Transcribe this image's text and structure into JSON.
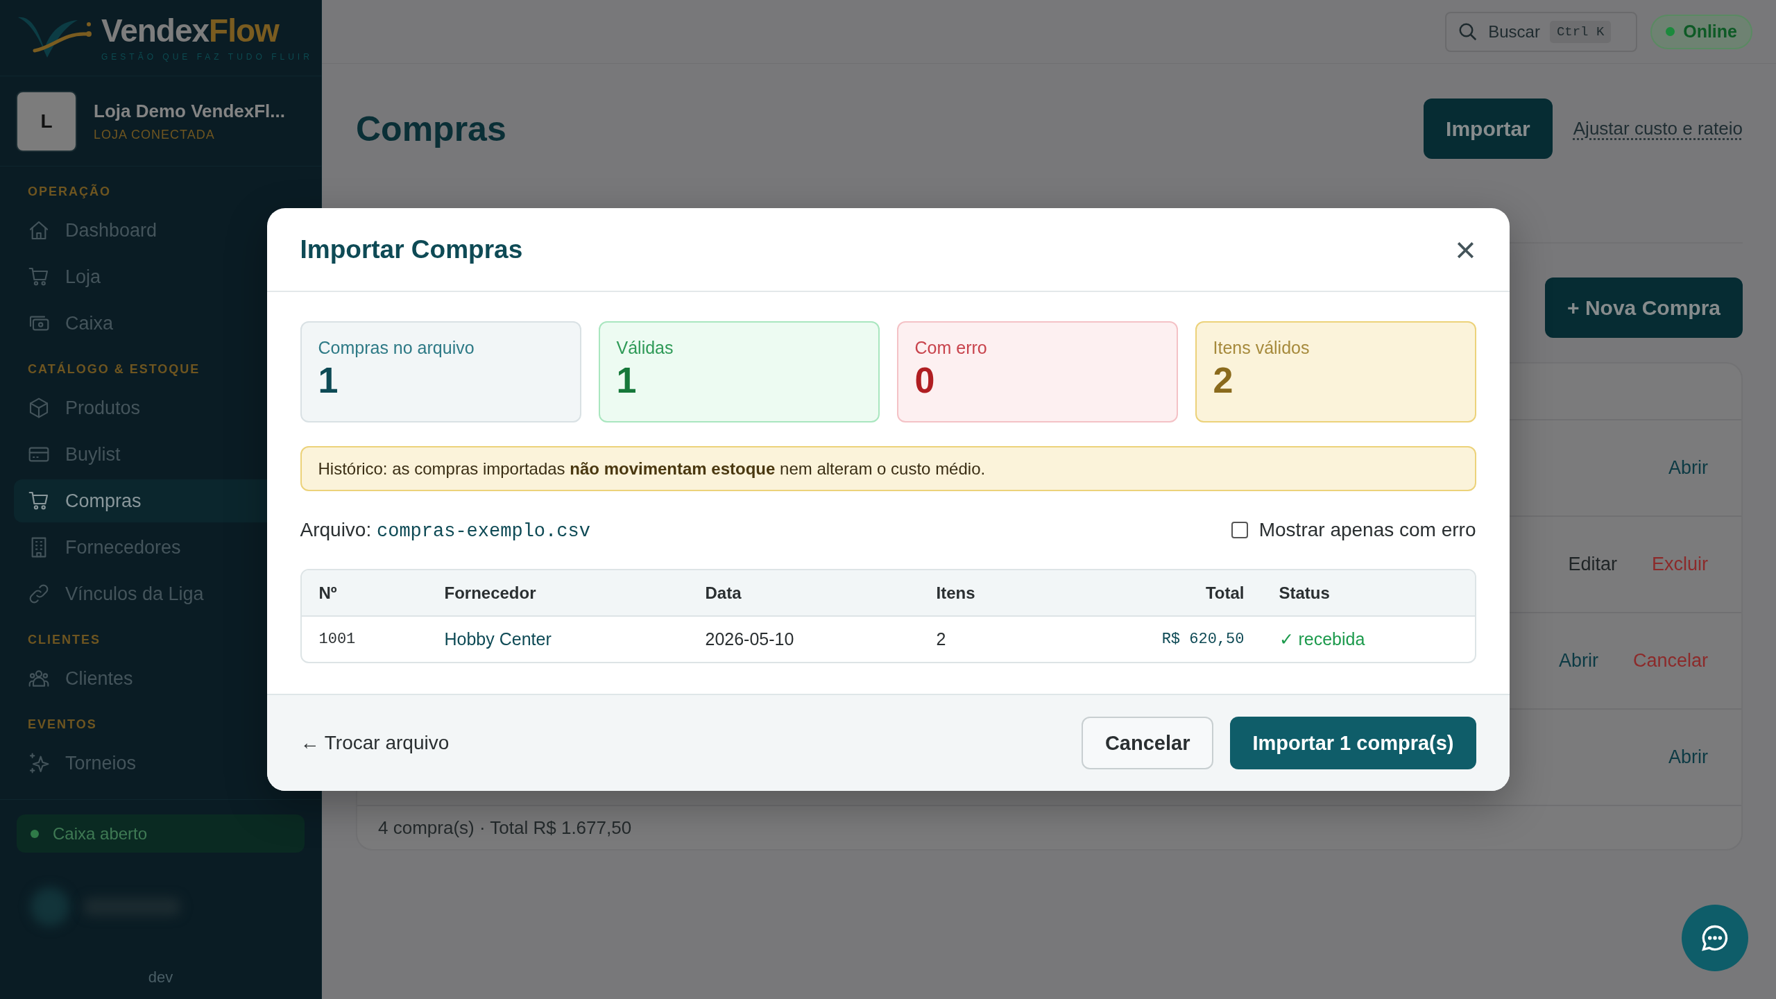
{
  "brand": {
    "name_main": "Vendex",
    "name_accent": "Flow",
    "tagline": "GESTÃO QUE FAZ TUDO FLUIR"
  },
  "store": {
    "initial": "L",
    "name": "Loja Demo VendexFl...",
    "status": "LOJA CONECTADA"
  },
  "sidebar": {
    "sections": [
      {
        "title": "OPERAÇÃO",
        "items": [
          {
            "kind": "home",
            "label": "Dashboard",
            "selected": false
          },
          {
            "kind": "shop",
            "label": "Loja",
            "selected": false
          },
          {
            "kind": "cash",
            "label": "Caixa",
            "selected": false
          }
        ]
      },
      {
        "title": "CATÁLOGO & ESTOQUE",
        "items": [
          {
            "kind": "products",
            "label": "Produtos",
            "selected": false
          },
          {
            "kind": "buylist",
            "label": "Buylist",
            "selected": false
          },
          {
            "kind": "shop",
            "label": "Compras",
            "selected": true
          },
          {
            "kind": "suppliers",
            "label": "Fornecedores",
            "selected": false
          },
          {
            "kind": "links",
            "label": "Vínculos da Liga",
            "selected": false
          }
        ]
      },
      {
        "title": "CLIENTES",
        "items": [
          {
            "kind": "customers",
            "label": "Clientes",
            "selected": false
          }
        ]
      },
      {
        "title": "EVENTOS",
        "items": [
          {
            "kind": "events",
            "label": "Torneios",
            "selected": false
          }
        ]
      }
    ],
    "register_status": "Caixa aberto",
    "env": "dev"
  },
  "topbar": {
    "search": {
      "label": "Buscar",
      "shortcut": "Ctrl K"
    },
    "status": "Online"
  },
  "page": {
    "title": "Compras",
    "import_button": "Importar",
    "adjust_link": "Ajustar custo e rateio",
    "new_button": "+ Nova Compra",
    "rows": [
      {
        "actions": [
          {
            "kind": "open",
            "label": "Abrir"
          }
        ]
      },
      {
        "actions": [
          {
            "kind": "edit",
            "label": "Editar"
          },
          {
            "kind": "delete",
            "label": "Excluir"
          }
        ]
      },
      {
        "actions": [
          {
            "kind": "open",
            "label": "Abrir"
          },
          {
            "kind": "delete",
            "label": "Cancelar"
          }
        ]
      },
      {
        "actions": [
          {
            "kind": "open",
            "label": "Abrir"
          }
        ]
      }
    ],
    "summary": "4 compra(s) · Total R$ 1.677,50"
  },
  "modal": {
    "title": "Importar Compras",
    "close": "×",
    "stats": [
      {
        "kind": "neutral",
        "label": "Compras no arquivo",
        "value": "1"
      },
      {
        "kind": "success",
        "label": "Válidas",
        "value": "1"
      },
      {
        "kind": "error",
        "label": "Com erro",
        "value": "0"
      },
      {
        "kind": "warning",
        "label": "Itens válidos",
        "value": "2"
      }
    ],
    "notice": "Histórico: as compras importadas **não movimentam estoque** nem alteram o custo médio.",
    "file_label": "Arquivo:",
    "file_name": "compras-exemplo.csv",
    "errors_only": {
      "label": "Mostrar apenas com erro",
      "checked": false
    },
    "table": {
      "columns": [
        "Nº",
        "Fornecedor",
        "Data",
        "Itens",
        "Total",
        "Status"
      ],
      "rows": [
        {
          "number": "1001",
          "supplier": "Hobby Center",
          "date": "2026-05-10",
          "items": "2",
          "total": "R$ 620,50",
          "status": "✓ recebida"
        }
      ]
    },
    "back_link": "← Trocar arquivo",
    "cancel_button": "Cancelar",
    "confirm_button": "Importar 1 compra(s)"
  }
}
